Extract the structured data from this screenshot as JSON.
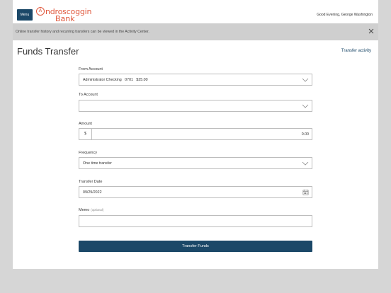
{
  "header": {
    "menu_label": "Menu",
    "logo": {
      "line1": "ndroscoggin",
      "line2": "Bank",
      "initial": "A"
    },
    "greeting": "Good Evening, George Washington"
  },
  "notice": {
    "text": "Online transfer history and recurring transfers can be viewed in the Activity Center."
  },
  "page": {
    "title": "Funds Transfer",
    "activity_link": "Transfer activity"
  },
  "form": {
    "from_account": {
      "label": "From Account",
      "value": "Administrator Checking   0701   $25.00"
    },
    "to_account": {
      "label": "To Account",
      "value": ""
    },
    "amount": {
      "label": "Amount",
      "prefix": "$",
      "value": "0.00"
    },
    "frequency": {
      "label": "Frequency",
      "value": "One time transfer"
    },
    "transfer_date": {
      "label": "Transfer Date",
      "value": "09/29/2022"
    },
    "memo": {
      "label": "Memo",
      "optional": "(optional)",
      "value": ""
    },
    "submit_label": "Transfer Funds"
  },
  "colors": {
    "brand": "#1b4868",
    "logo": "#e05a3f",
    "notice_bg": "#cfcfcf",
    "page_bg": "#d6d6d6"
  },
  "icons": [
    "close-icon",
    "chevron-down-icon",
    "calendar-icon"
  ]
}
